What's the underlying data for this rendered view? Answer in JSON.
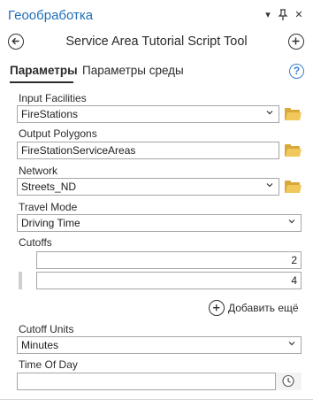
{
  "pane": {
    "title": "Геообработка",
    "controls": {
      "dropdown": "▾",
      "pin": "ᵖ",
      "close": "✕"
    }
  },
  "tool": {
    "title": "Service Area Tutorial Script Tool"
  },
  "tabs": [
    {
      "label": "Параметры",
      "active": true
    },
    {
      "label": "Параметры среды",
      "active": false
    }
  ],
  "help": {
    "symbol": "?"
  },
  "params": {
    "input_facilities": {
      "label": "Input Facilities",
      "value": "FireStations"
    },
    "output_polygons": {
      "label": "Output Polygons",
      "value": "FireStationServiceAreas"
    },
    "network": {
      "label": "Network",
      "value": "Streets_ND"
    },
    "travel_mode": {
      "label": "Travel Mode",
      "value": "Driving Time"
    },
    "cutoffs": {
      "label": "Cutoffs",
      "values": [
        "2",
        "4"
      ]
    },
    "add_more": {
      "label": "Добавить ещё"
    },
    "cutoff_units": {
      "label": "Cutoff Units",
      "value": "Minutes"
    },
    "time_of_day": {
      "label": "Time Of Day",
      "value": ""
    }
  },
  "colors": {
    "title_blue": "#1f6fb8",
    "help_blue": "#3a7fcf",
    "folder": "#f2c75c",
    "border": "#a6a6a6"
  },
  "icons": [
    "back-icon",
    "add-icon",
    "help-icon",
    "folder-icon",
    "chevron-down-icon",
    "clock-icon",
    "plus-icon"
  ]
}
